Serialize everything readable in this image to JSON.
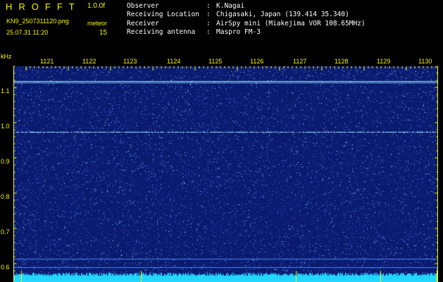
{
  "header": {
    "app_title": "HROFFT",
    "app_version": "1.0.0f",
    "file_name": "KN9_2507311120.png",
    "meteor_label": "meteor",
    "meteor_count": "15",
    "datetime": "25.07.31 11:20"
  },
  "info": [
    {
      "key": "Observer",
      "value": "K.Nagai"
    },
    {
      "key": "Receiving Location",
      "value": "Chigasaki, Japan (139.414 35.340)"
    },
    {
      "key": "Receiver",
      "value": "AirSpy mini (Miakejima VOR 108.65MHz)"
    },
    {
      "key": "Receiving antenna",
      "value": "Maspro FM-3"
    }
  ],
  "axis": {
    "y_unit": "kHz",
    "x_labels": [
      "1121",
      "1122",
      "1123",
      "1124",
      "1125",
      "1126",
      "1127",
      "1128",
      "1129",
      "1130"
    ],
    "y_labels": [
      "1.1",
      "1.0",
      "0.9",
      "0.8",
      "0.7",
      "0.6"
    ]
  },
  "spectrogram": {
    "background_color": "#0a1a6e",
    "noise_colors": [
      "#1c3ba8",
      "#2f5ad8",
      "#4a86f0",
      "#7fc0ff",
      "#cfe8ff"
    ],
    "bright_line_color": "#9cf0ff",
    "floor_color": "#22d6ff",
    "axis_color": "#f6f600"
  }
}
